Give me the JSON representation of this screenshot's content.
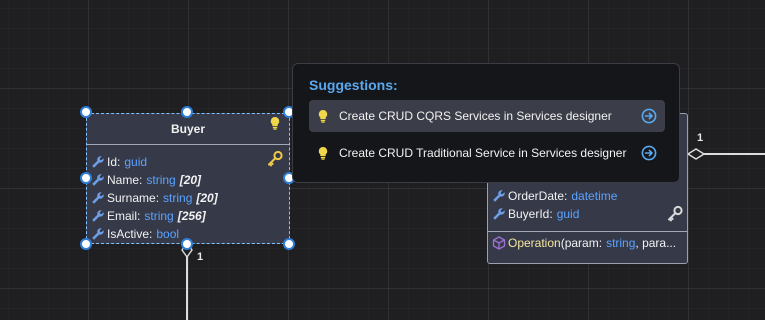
{
  "buyer": {
    "title": "Buyer",
    "attributes": [
      {
        "name": "Id",
        "type": "guid",
        "size": ""
      },
      {
        "name": "Name",
        "type": "string",
        "size": "[20]"
      },
      {
        "name": "Surname",
        "type": "string",
        "size": "[20]"
      },
      {
        "name": "Email",
        "type": "string",
        "size": "[256]"
      },
      {
        "name": "IsActive",
        "type": "bool",
        "size": ""
      }
    ],
    "multiplicity_bottom": "1"
  },
  "order": {
    "attributes": [
      {
        "name": "OrderDate",
        "type": "datetime"
      },
      {
        "name": "BuyerId",
        "type": "guid"
      }
    ],
    "operation": {
      "name": "Operation",
      "open": "(",
      "param_name": "param",
      "param_type": "string",
      "rest": ", para..."
    },
    "multiplicity_right": "1"
  },
  "suggestions": {
    "title": "Suggestions:",
    "items": [
      {
        "label": "Create CRUD CQRS Services in Services designer"
      },
      {
        "label": "Create CRUD Traditional Service in Services designer"
      }
    ]
  },
  "icons": {
    "attribute": "wrench-icon",
    "primary_key": "key-icon",
    "suggestion": "lightbulb-icon",
    "go": "arrow-circle-icon",
    "operation": "cube-icon"
  },
  "colors": {
    "type": "#5ba2ff",
    "selection": "#2f7fd8",
    "bulb": "#f0d64a",
    "popup_title": "#5aa8ee"
  }
}
